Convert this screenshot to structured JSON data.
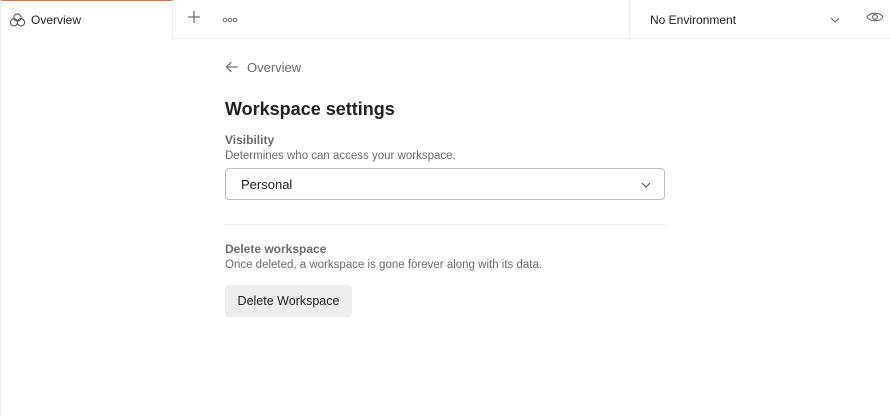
{
  "tabs": {
    "active_label": "Overview"
  },
  "environment": {
    "selected": "No Environment"
  },
  "content": {
    "back_label": "Overview",
    "page_title": "Workspace settings",
    "visibility": {
      "title": "Visibility",
      "description": "Determines who can access your workspace.",
      "selected": "Personal"
    },
    "delete": {
      "title": "Delete workspace",
      "description": "Once deleted, a workspace is gone forever along with its data.",
      "button_label": "Delete Workspace"
    }
  },
  "colors": {
    "accent": "#ff6c37",
    "border": "#ededed",
    "muted_text": "#6b6b6b",
    "text": "#212121",
    "button_bg": "#ededed"
  },
  "icons": [
    "workspace-overview-icon",
    "plus-icon",
    "more-options-icon",
    "chevron-down-icon",
    "eye-icon",
    "arrow-left-icon"
  ]
}
